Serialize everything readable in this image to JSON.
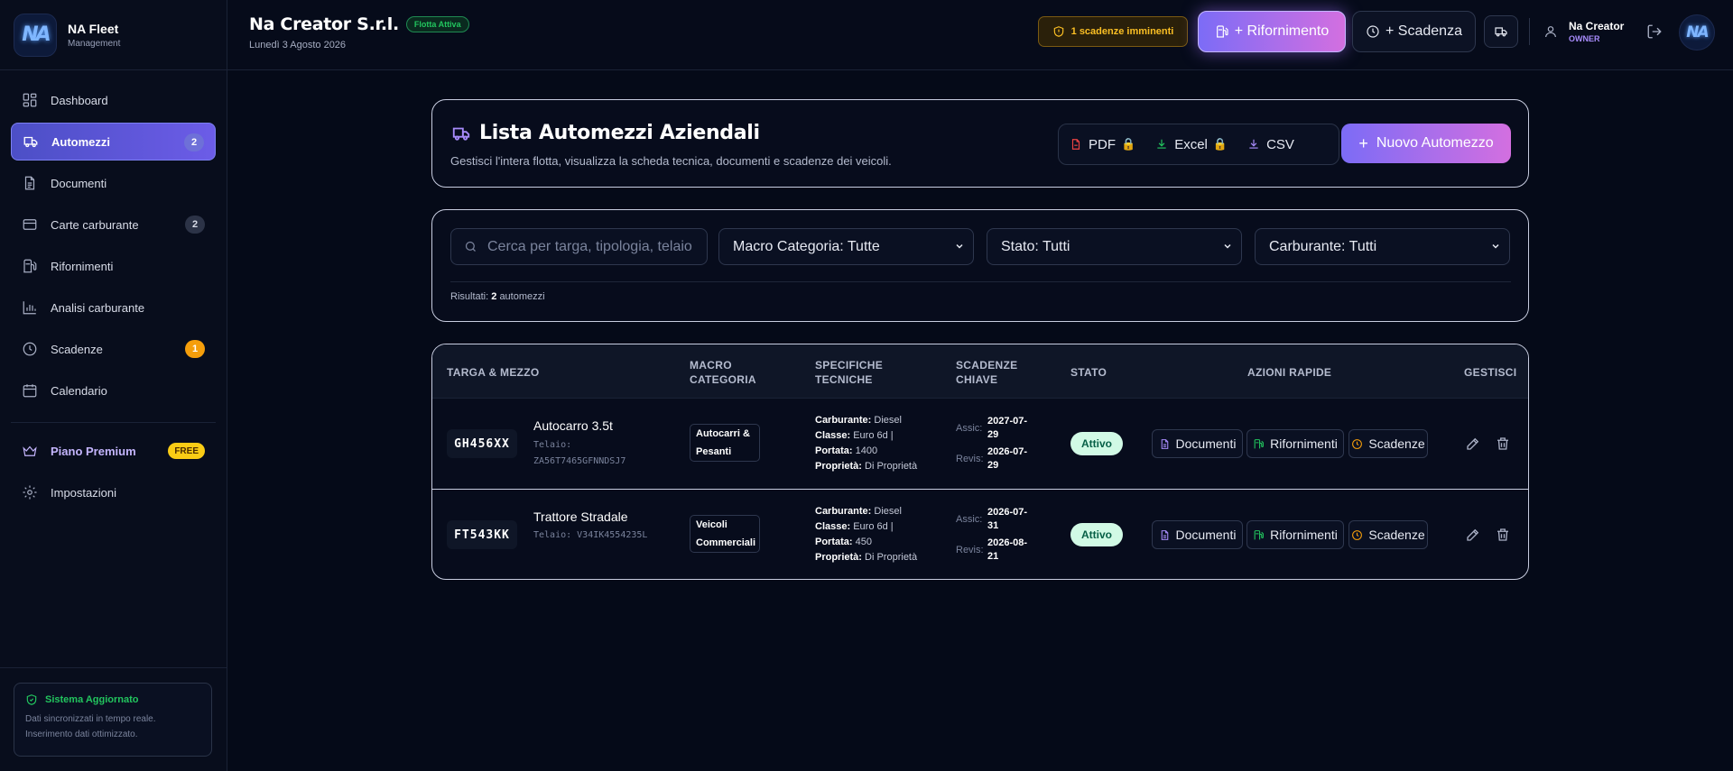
{
  "brand": {
    "name": "NA Fleet",
    "subtitle": "Management",
    "logo_text": "NA"
  },
  "sidebar": {
    "items": [
      {
        "label": "Dashboard",
        "icon": "dashboard-icon",
        "badge": ""
      },
      {
        "label": "Automezzi",
        "icon": "truck-icon",
        "badge": "2",
        "active": true
      },
      {
        "label": "Documenti",
        "icon": "document-icon",
        "badge": ""
      },
      {
        "label": "Carte carburante",
        "icon": "credit-card-icon",
        "badge": "2"
      },
      {
        "label": "Rifornimenti",
        "icon": "fuel-pump-icon",
        "badge": ""
      },
      {
        "label": "Analisi carburante",
        "icon": "bar-chart-icon",
        "badge": ""
      },
      {
        "label": "Scadenze",
        "icon": "clock-icon",
        "badge": "1"
      },
      {
        "label": "Calendario",
        "icon": "calendar-icon",
        "badge": ""
      }
    ],
    "premium": {
      "label": "Piano Premium",
      "badge": "FREE"
    },
    "settings": {
      "label": "Impostazioni"
    },
    "status": {
      "title": "Sistema Aggiornato",
      "line1": "Dati sincronizzati in tempo reale.",
      "line2": "Inserimento dati ottimizzato."
    }
  },
  "header": {
    "company": "Na Creator S.r.l.",
    "fleet_badge": "Flotta Attiva",
    "date": "Lunedì 3 Agosto 2026",
    "warning": "1 scadenze imminenti",
    "refuel_button": "+ Rifornimento",
    "deadline_button": "+ Scadenza",
    "user": {
      "name": "Na Creator",
      "role": "OWNER"
    },
    "avatar_text": "NA"
  },
  "main": {
    "title": "Lista Automezzi Aziendali",
    "subtitle": "Gestisci l'intera flotta, visualizza la scheda tecnica, documenti e scadenze dei veicoli.",
    "exports": {
      "pdf": "PDF",
      "excel": "Excel",
      "csv": "CSV",
      "lock": "🔒"
    },
    "new_button": "Nuovo Automezzo",
    "filters": {
      "search_placeholder": "Cerca per targa, tipologia, telaio",
      "macro": "Macro Categoria: Tutte",
      "stato": "Stato: Tutti",
      "carburante": "Carburante: Tutti"
    },
    "results": {
      "prefix": "Risultati:",
      "count": "2",
      "suffix": "automezzi"
    }
  },
  "table": {
    "headers": {
      "targa": "TARGA & MEZZO",
      "macro_1": "MACRO",
      "macro_2": "CATEGORIA",
      "specs_1": "SPECIFICHE",
      "specs_2": "TECNICHE",
      "dead_1": "SCADENZE",
      "dead_2": "CHIAVE",
      "stato": "STATO",
      "azioni": "AZIONI RAPIDE",
      "gestisci": "GESTISCI"
    },
    "rows": [
      {
        "plate": "GH456XX",
        "name": "Autocarro 3.5t",
        "chassis_1": "Telaio:",
        "chassis_2": "ZA56T7465GFNNDSJ7",
        "macro_1": "Autocarri &",
        "macro_2": "Pesanti",
        "fuel_label": "Carburante:",
        "fuel": "Diesel",
        "class_label": "Classe:",
        "class": "Euro 6d |",
        "load_label": "Portata:",
        "load": "1400",
        "own_label": "Proprietà:",
        "own": "Di Proprietà",
        "assic_label": "Assic:",
        "assic_1": "2027-07-",
        "assic_2": "29",
        "revis_label": "Revis:",
        "revis_1": "2026-07-",
        "revis_2": "29",
        "stato": "Attivo",
        "qa_docs": "Documenti",
        "qa_refuel": "Rifornimenti",
        "qa_deadlines": "Scadenze"
      },
      {
        "plate": "FT543KK",
        "name": "Trattore Stradale",
        "chassis_1": "Telaio: V34IK4554235L",
        "chassis_2": "",
        "macro_1": "Veicoli",
        "macro_2": "Commerciali",
        "fuel_label": "Carburante:",
        "fuel": "Diesel",
        "class_label": "Classe:",
        "class": "Euro 6d |",
        "load_label": "Portata:",
        "load": "450",
        "own_label": "Proprietà:",
        "own": "Di Proprietà",
        "assic_label": "Assic:",
        "assic_1": "2026-07-",
        "assic_2": "31",
        "revis_label": "Revis:",
        "revis_1": "2026-08-",
        "revis_2": "21",
        "stato": "Attivo",
        "qa_docs": "Documenti",
        "qa_refuel": "Rifornimenti",
        "qa_deadlines": "Scadenze"
      }
    ]
  },
  "colors": {
    "accent_start": "#7c6cf6",
    "accent_end": "#d36fe0",
    "success": "#22c55e",
    "warning": "#fbbf24",
    "background": "#050a18"
  }
}
